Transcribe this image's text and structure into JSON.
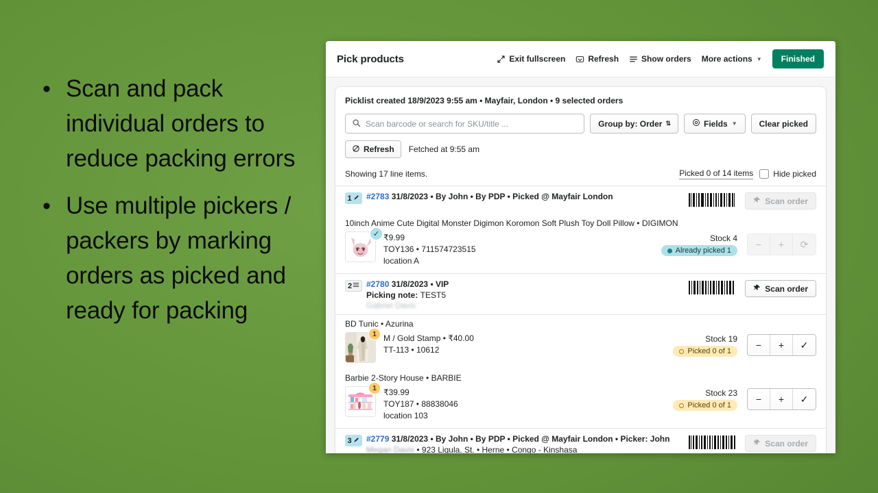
{
  "slide": {
    "bullets": [
      "Scan and pack individual orders to reduce packing errors",
      "Use multiple pickers / packers by marking orders as picked and ready for packing"
    ],
    "bullet_marker": "•",
    "background_color": "#629339"
  },
  "app": {
    "title": "Pick products",
    "accent_color": "#008060",
    "topbar": {
      "exit_fullscreen": "Exit fullscreen",
      "refresh": "Refresh",
      "show_orders": "Show orders",
      "more_actions": "More actions",
      "finished": "Finished"
    },
    "picklist_meta": "Picklist created 18/9/2023 9:55 am • Mayfair, London • 9 selected orders",
    "filters": {
      "search_placeholder": "Scan barcode or search for SKU/title ...",
      "search_value": "",
      "group_by": "Group by: Order",
      "fields": "Fields",
      "clear_picked": "Clear picked"
    },
    "refresh_row": {
      "refresh_label": "Refresh",
      "fetched_at": "Fetched at 9:55 am"
    },
    "summary": {
      "showing": "Showing 17 line items.",
      "picked_count": "Picked 0 of 14 items",
      "hide_picked": "Hide picked",
      "hide_picked_checked": false
    },
    "scan_order_label": "Scan order",
    "orders": [
      {
        "index": "1",
        "index_icon": "pen-icon",
        "badge_style": "blue",
        "number": "#2783",
        "meta": "31/8/2023 • By John • By PDP • Picked @ Mayfair London",
        "scan_enabled": false,
        "items": [
          {
            "title": "10inch Anime Cute Digital Monster Digimon Koromon Soft Plush Toy Doll Pillow • DIGIMON",
            "thumb": "plush-toy-thumbnail",
            "bubble": "check",
            "bubble_value": "✓",
            "price": "₹9.99",
            "sku_line": "TOY136 • 711574723515",
            "location": "location A",
            "stock": "Stock 4",
            "pick_status": "Already picked 1",
            "pick_status_style": "teal",
            "stepper_enabled": false,
            "stepper_buttons": [
              "−",
              "+",
              "⟳"
            ]
          }
        ]
      },
      {
        "index": "2",
        "index_icon": "list-icon",
        "badge_style": "grey",
        "number": "#2780",
        "meta": "31/8/2023 • VIP",
        "picking_note_label": "Picking note:",
        "picking_note_value": "TEST5",
        "customer_line": "Gabriel Davis",
        "scan_enabled": true,
        "items": [
          {
            "title": "BD Tunic • Azurina",
            "thumb": "apparel-thumbnail",
            "bubble": "qty",
            "bubble_value": "1",
            "price": "M / Gold Stamp • ₹40.00",
            "sku_line": "TT-113 • 10612",
            "location": "",
            "stock": "Stock 19",
            "pick_status": "Picked 0 of 1",
            "pick_status_style": "amber",
            "stepper_enabled": true,
            "stepper_buttons": [
              "−",
              "+",
              "✓"
            ]
          },
          {
            "title": "Barbie 2-Story House • BARBIE",
            "thumb": "dollhouse-thumbnail",
            "bubble": "qty",
            "bubble_value": "1",
            "price": "₹39.99",
            "sku_line": "TOY187 • 88838046",
            "location": "location 103",
            "stock": "Stock 23",
            "pick_status": "Picked 0 of 1",
            "pick_status_style": "amber",
            "stepper_enabled": true,
            "stepper_buttons": [
              "−",
              "+",
              "✓"
            ]
          }
        ]
      },
      {
        "index": "3",
        "index_icon": "pen-icon",
        "badge_style": "blue",
        "number": "#2779",
        "meta": "31/8/2023 • By John • By PDP • Picked @ Mayfair London • Picker: John",
        "address_blurred": "Megan Davis",
        "address_rest": " • 923 Ligula. St. • Herne • Congo - Kinshasa",
        "scan_enabled": false,
        "items": []
      }
    ]
  }
}
